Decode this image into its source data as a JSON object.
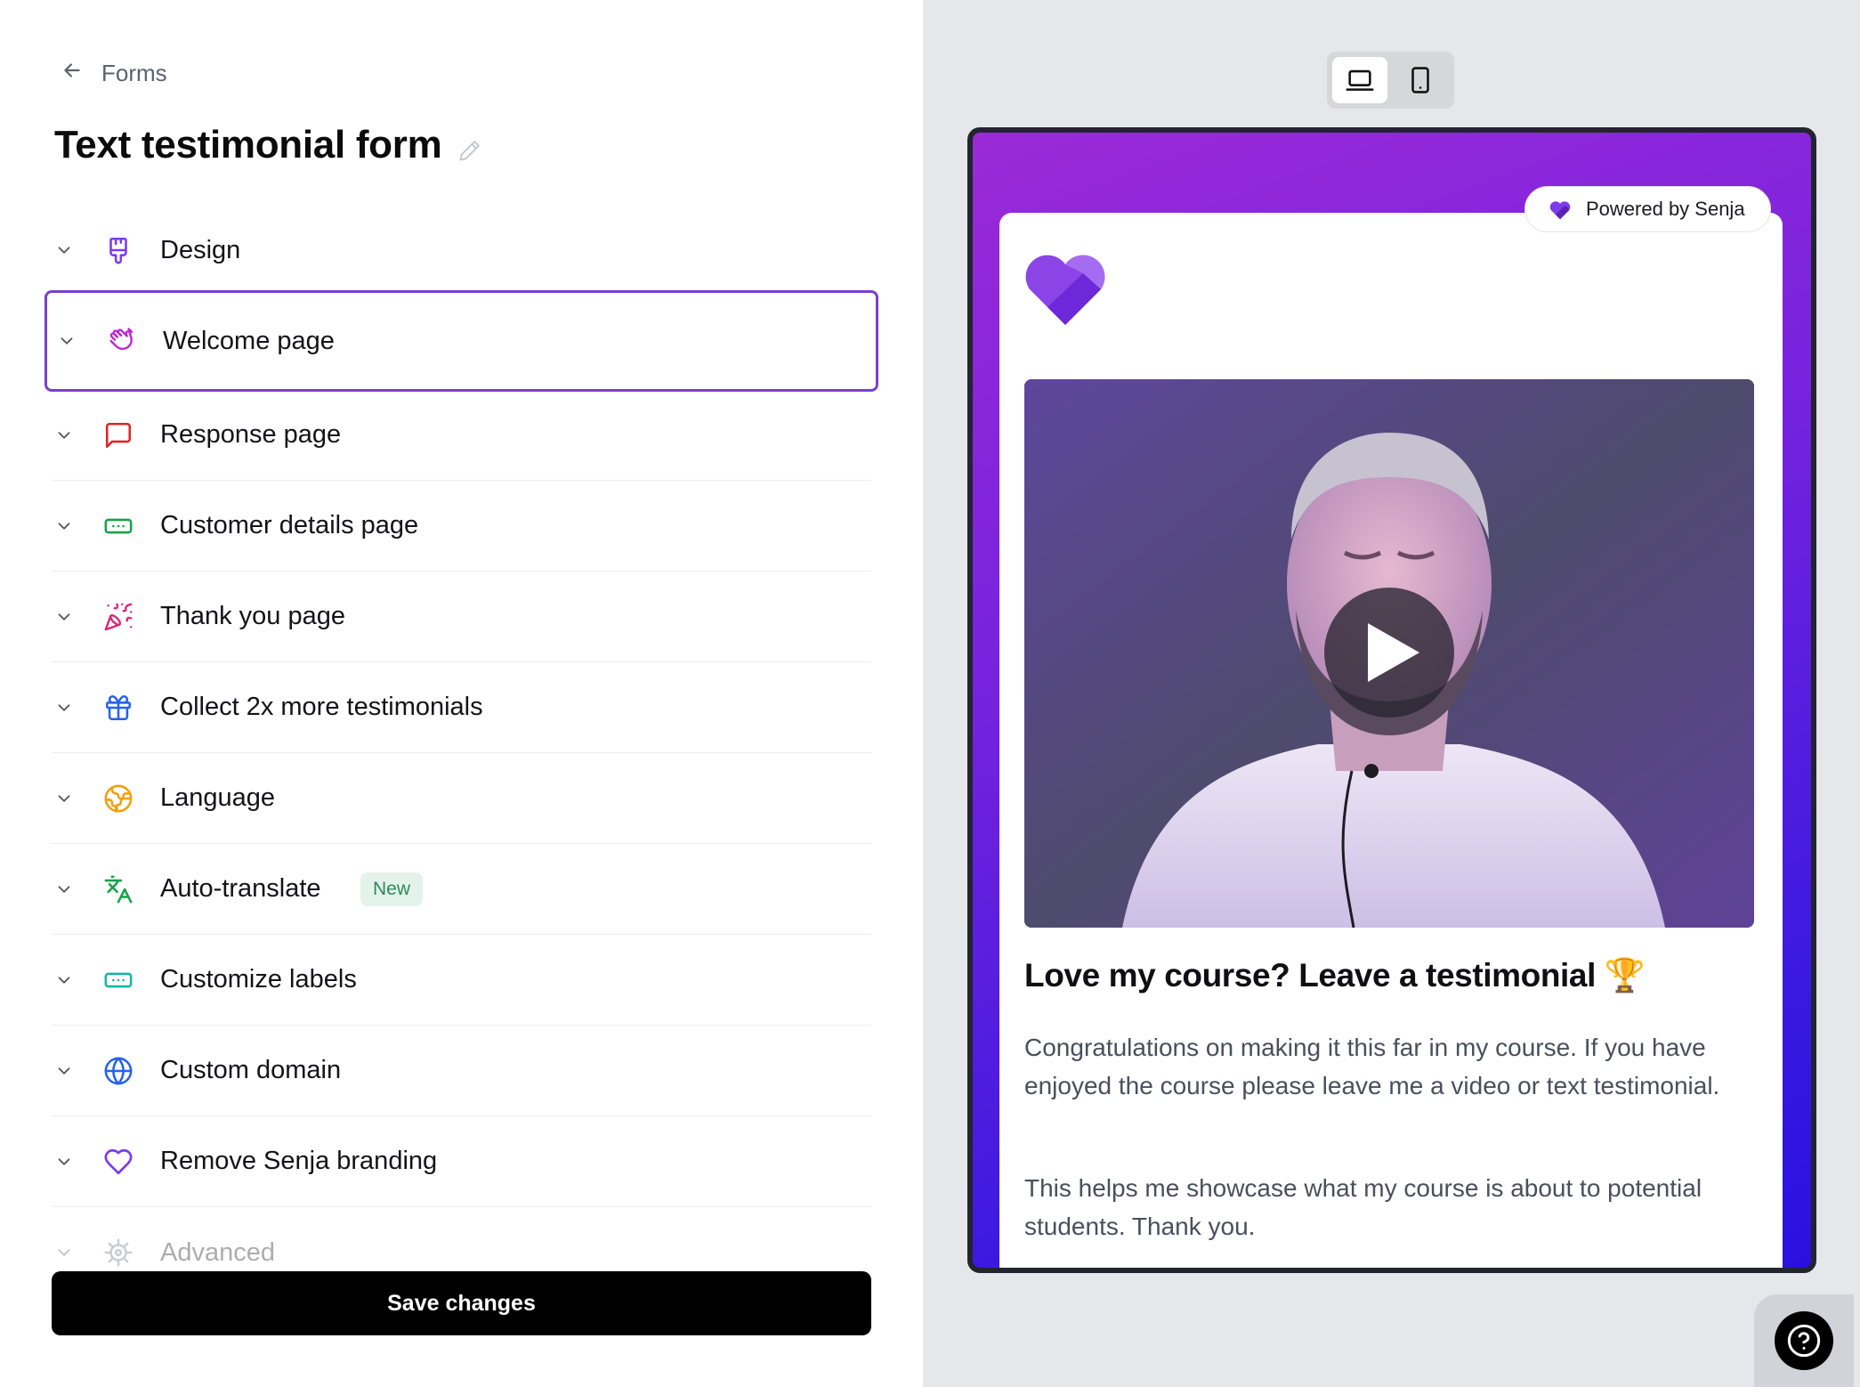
{
  "header": {
    "back_label": "Forms",
    "title": "Text testimonial form"
  },
  "menu": {
    "items": [
      {
        "label": "Design",
        "icon": "paintbrush-icon",
        "color": "#7c3aed"
      },
      {
        "label": "Welcome page",
        "icon": "waving-hand-icon",
        "color": "#c026d3",
        "active": true
      },
      {
        "label": "Response page",
        "icon": "message-square-icon",
        "color": "#dc2626"
      },
      {
        "label": "Customer details page",
        "icon": "form-input-icon",
        "color": "#16a34a"
      },
      {
        "label": "Thank you page",
        "icon": "party-popper-icon",
        "color": "#db2777"
      },
      {
        "label": "Collect 2x more testimonials",
        "icon": "gift-icon",
        "color": "#2563eb"
      },
      {
        "label": "Language",
        "icon": "earth-icon",
        "color": "#f59e0b"
      },
      {
        "label": "Auto-translate",
        "icon": "languages-icon",
        "color": "#16a34a",
        "badge": "New"
      },
      {
        "label": "Customize labels",
        "icon": "text-cursor-input-icon",
        "color": "#14b8a6"
      },
      {
        "label": "Custom domain",
        "icon": "globe-icon",
        "color": "#2563eb"
      },
      {
        "label": "Remove Senja branding",
        "icon": "heart-icon",
        "color": "#7c3aed"
      },
      {
        "label": "Advanced",
        "icon": "cog-icon",
        "color": "#6b7280"
      }
    ]
  },
  "save_label": "Save changes",
  "preview": {
    "device_toggle": {
      "desktop": "laptop-icon",
      "mobile": "smartphone-icon",
      "selected": "desktop"
    },
    "powered_by": "Powered by Senja",
    "headline": "Love my course? Leave a testimonial 🏆",
    "paragraph1": "Congratulations on making it this far in my course. If you have enjoyed the course please leave me a video or text testimonial.",
    "paragraph2": "This helps me showcase what my course is about to potential students. Thank you.",
    "accent": "#7c3aed"
  },
  "help": {
    "icon": "help-circle-icon"
  }
}
